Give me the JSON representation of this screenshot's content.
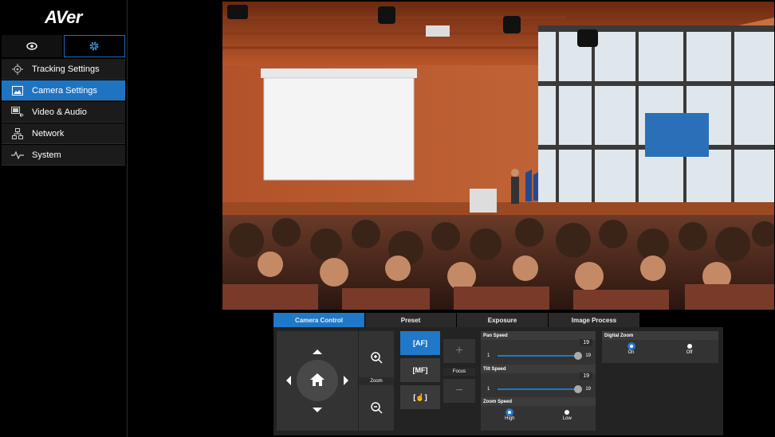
{
  "app": {
    "logo": "AVer"
  },
  "sidebar": {
    "mode_tabs": [
      {
        "name": "view-tab",
        "icon": "eye-icon",
        "active": false
      },
      {
        "name": "settings-tab",
        "icon": "gear-icon",
        "active": true
      }
    ],
    "items": [
      {
        "label": "Tracking Settings",
        "icon": "crosshair-icon",
        "active": false
      },
      {
        "label": "Camera Settings",
        "icon": "image-icon",
        "active": true
      },
      {
        "label": "Video & Audio",
        "icon": "video-audio-icon",
        "active": false
      },
      {
        "label": "Network",
        "icon": "network-icon",
        "active": false
      },
      {
        "label": "System",
        "icon": "pulse-icon",
        "active": false
      }
    ]
  },
  "tabs": [
    {
      "label": "Camera Control",
      "active": true
    },
    {
      "label": "Preset",
      "active": false
    },
    {
      "label": "Exposure",
      "active": false
    },
    {
      "label": "Image Process",
      "active": false
    }
  ],
  "camera_control": {
    "zoom_label": "Zoom",
    "focus_label": "Focus",
    "focus_buttons": [
      {
        "label": "[AF]",
        "active": true
      },
      {
        "label": "[MF]",
        "active": false
      },
      {
        "label": "[☝]",
        "active": false
      }
    ],
    "pan_speed": {
      "label": "Pan Speed",
      "value": "19",
      "min": "1",
      "max": "19"
    },
    "tilt_speed": {
      "label": "Tilt Speed",
      "value": "19",
      "min": "1",
      "max": "19"
    },
    "zoom_speed": {
      "label": "Zoom Speed",
      "options": [
        "High",
        "Low"
      ],
      "selected": "High"
    },
    "digital_zoom": {
      "label": "Digital Zoom",
      "options": [
        "On",
        "Off"
      ],
      "selected": "On"
    }
  },
  "colors": {
    "accent": "#1f78c8",
    "panel": "#232323",
    "sidebar": "#000000"
  }
}
